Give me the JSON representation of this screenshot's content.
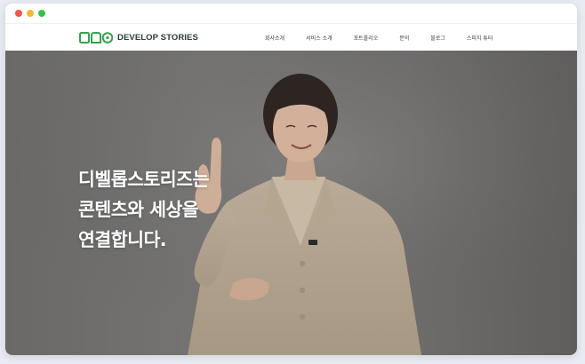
{
  "browser": {
    "window_controls": [
      "close-dot",
      "minimize-dot",
      "maximize-dot"
    ]
  },
  "header": {
    "logo_text": "DEVELOP STORIES",
    "logo_color": "#3aa14a",
    "nav": [
      {
        "label": "회사소개"
      },
      {
        "label": "서비스 소개"
      },
      {
        "label": "포트폴리오"
      },
      {
        "label": "문의"
      },
      {
        "label": "블로그"
      },
      {
        "label": "스피치 튜터"
      }
    ]
  },
  "hero": {
    "headline_lines": [
      "디벨롭스토리즈는",
      "콘텐츠와 세상을",
      "연결합니다."
    ],
    "image": "woman-presenter-pointing-up"
  }
}
